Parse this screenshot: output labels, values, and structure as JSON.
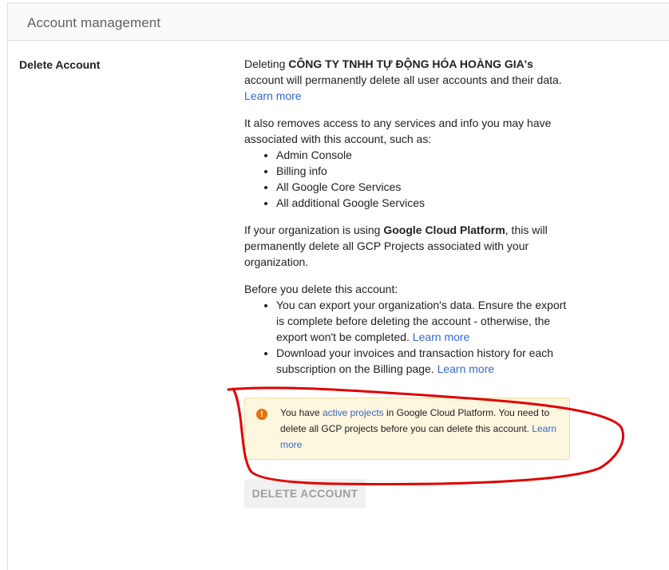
{
  "header": {
    "title": "Account management"
  },
  "section": {
    "label": "Delete Account"
  },
  "content": {
    "p1": {
      "before": "Deleting ",
      "org_name": "CÔNG TY TNHH TỰ ĐỘNG HÓA HOÀNG GIA's",
      "after": " account will permanently delete all user accounts and their data. ",
      "link": "Learn more"
    },
    "p2": {
      "text": "It also removes access to any services and info you may have associated with this account, such as:",
      "items": [
        "Admin Console",
        "Billing info",
        "All Google Core Services",
        "All additional Google Services"
      ]
    },
    "p3": {
      "before": "If your organization is using ",
      "bold": "Google Cloud Platform",
      "after": ", this will permanently delete all GCP Projects associated with your organization."
    },
    "p4": {
      "text": "Before you delete this account:",
      "item1_text": "You can export your organization's data. Ensure the export is complete before deleting the account - otherwise, the export won't be completed. ",
      "item1_link": "Learn more",
      "item2_text": "Download your invoices and transaction history for each subscription on the Billing page. ",
      "item2_link": "Learn more"
    }
  },
  "alert": {
    "icon": "!",
    "before": "You have ",
    "link1": "active projects",
    "middle": " in Google Cloud Platform. You need to delete all GCP projects before you can delete this account. ",
    "link2": "Learn more"
  },
  "button": {
    "label": "DELETE ACCOUNT"
  },
  "colors": {
    "link": "#3367d6",
    "alert_bg": "#fef7e0",
    "alert_icon": "#e8710a",
    "annotation": "#e00000"
  }
}
